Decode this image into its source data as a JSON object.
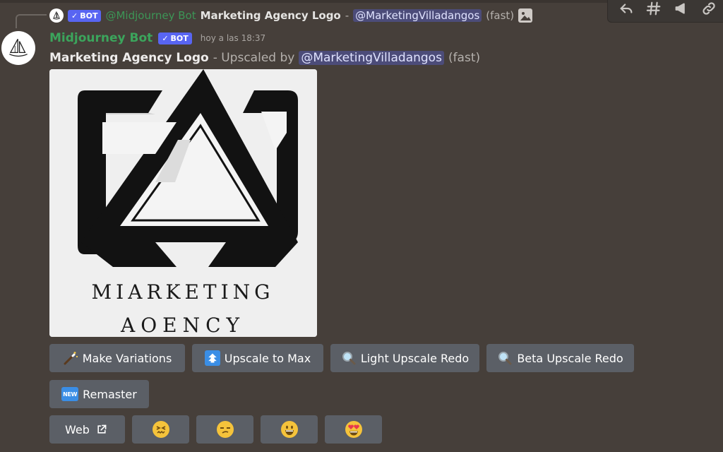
{
  "reply": {
    "bot_tag": "BOT",
    "author": "@Midjourney Bot",
    "title": "Marketing Agency Logo",
    "separator": "-",
    "mention": "@MarketingVilladangos",
    "speed": "(fast)",
    "image_icon": "image-icon"
  },
  "message": {
    "author": "Midjourney Bot",
    "bot_tag": "BOT",
    "timestamp": "hoy a las 18:37",
    "title": "Marketing Agency Logo",
    "upscaled_by": "- Upscaled by",
    "mention": "@MarketingVilladangos",
    "speed": "(fast)"
  },
  "attachment": {
    "text_line1": "MIARKETING",
    "text_line2": "AOENCY"
  },
  "buttons": {
    "row1": [
      {
        "label": "Make Variations",
        "icon": "magic-wand-icon"
      },
      {
        "label": "Upscale to Max",
        "icon": "up-arrow-icon"
      },
      {
        "label": "Light Upscale Redo",
        "icon": "magnifier-icon"
      },
      {
        "label": "Beta Upscale Redo",
        "icon": "magnifier-icon"
      }
    ],
    "row2": [
      {
        "label": "Remaster",
        "icon": "new-badge-icon",
        "badge": "NEW"
      }
    ],
    "row3": [
      {
        "label": "Web",
        "icon": "external-link-icon"
      },
      {
        "label": "",
        "icon": "confounded-face-icon"
      },
      {
        "label": "",
        "icon": "unamused-face-icon"
      },
      {
        "label": "",
        "icon": "grinning-face-icon"
      },
      {
        "label": "",
        "icon": "heart-eyes-face-icon"
      }
    ]
  },
  "toolbar": [
    "reply-icon",
    "thread-icon",
    "megaphone-icon",
    "link-icon"
  ],
  "colors": {
    "background": "#463f3a",
    "author": "#3ba55c",
    "bot_tag": "#5865f2",
    "button": "#5b5f66"
  }
}
